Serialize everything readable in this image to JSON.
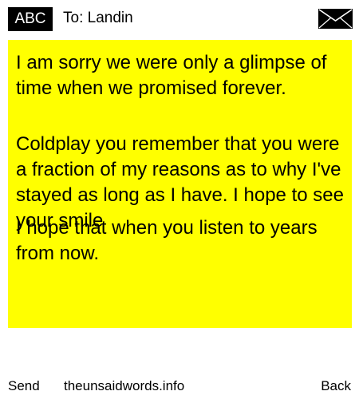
{
  "header": {
    "badge": "ABC",
    "to_line": "To: Landin",
    "mail_icon": "envelope-icon"
  },
  "message": {
    "paragraph_1": "I am sorry we were only a glimpse of time when we promised forever.",
    "paragraph_2": "Coldplay you remember that you were a fraction of my reasons as to why I've stayed as long as I have. I hope to see your smile",
    "paragraph_3": "I hope that when you listen to years from now."
  },
  "footer": {
    "send_label": "Send",
    "site_label": "theunsaidwords.info",
    "back_label": "Back"
  },
  "colors": {
    "panel_background": "#ffff00",
    "badge_background": "#000000",
    "badge_text": "#ffffff"
  }
}
